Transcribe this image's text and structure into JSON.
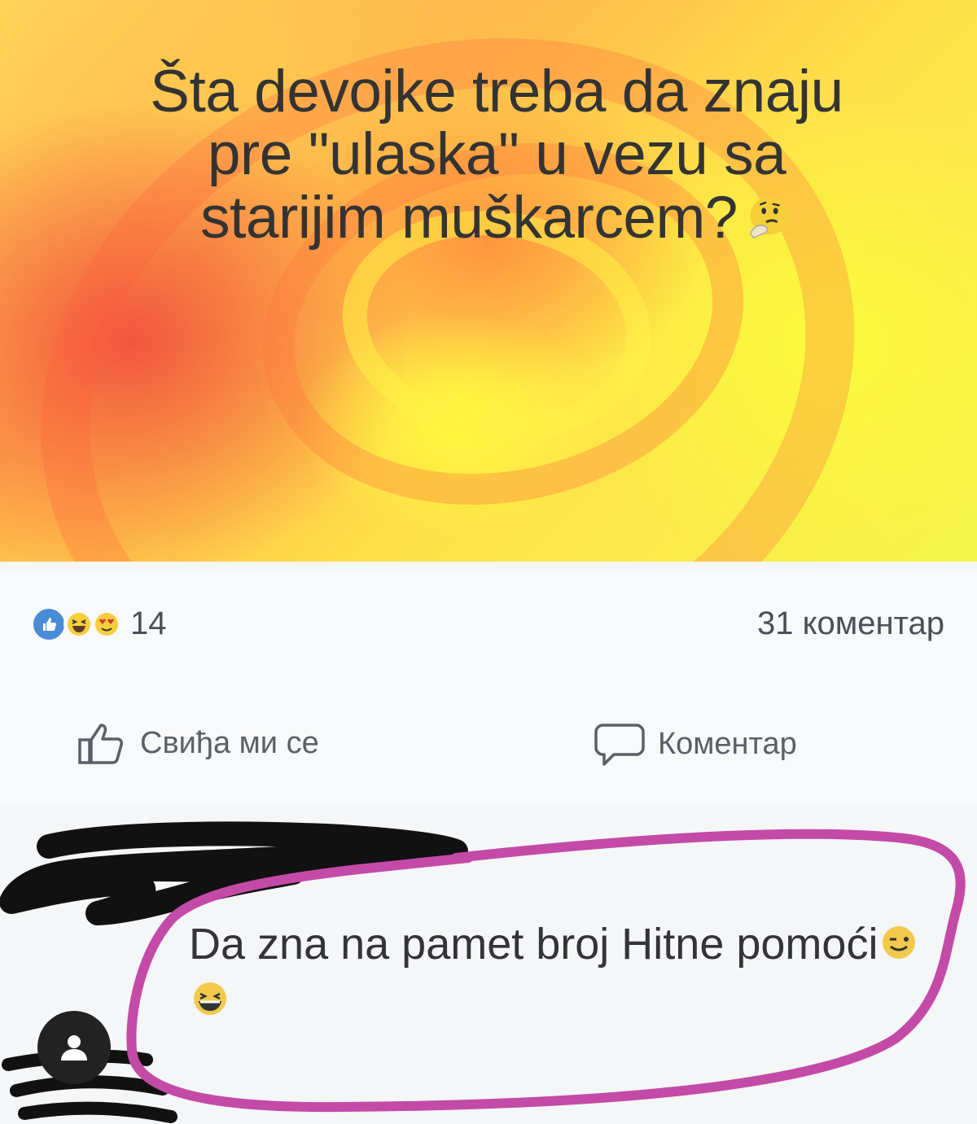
{
  "post": {
    "title": "Šta devojke treba da znaju pre \"ulaska\" u vezu sa starijim muškarcem?",
    "title_emoji": "thinking-face-icon"
  },
  "stats": {
    "reaction_icons": [
      "like-reaction-icon",
      "haha-reaction-icon",
      "love-eyes-reaction-icon"
    ],
    "reaction_count": "14",
    "comment_count": "31 коментар"
  },
  "actions": {
    "like_label": "Свиђа ми се",
    "comment_label": "Коментар"
  },
  "comment": {
    "text": "Da zna na pamet broj Hitne pomoći",
    "emojis": [
      "winking-face-icon",
      "grinning-face-icon"
    ],
    "author_redacted": true
  },
  "colors": {
    "highlight": "#c44aa8",
    "like_blue": "#4a8bd8",
    "text_dark": "#333333"
  }
}
